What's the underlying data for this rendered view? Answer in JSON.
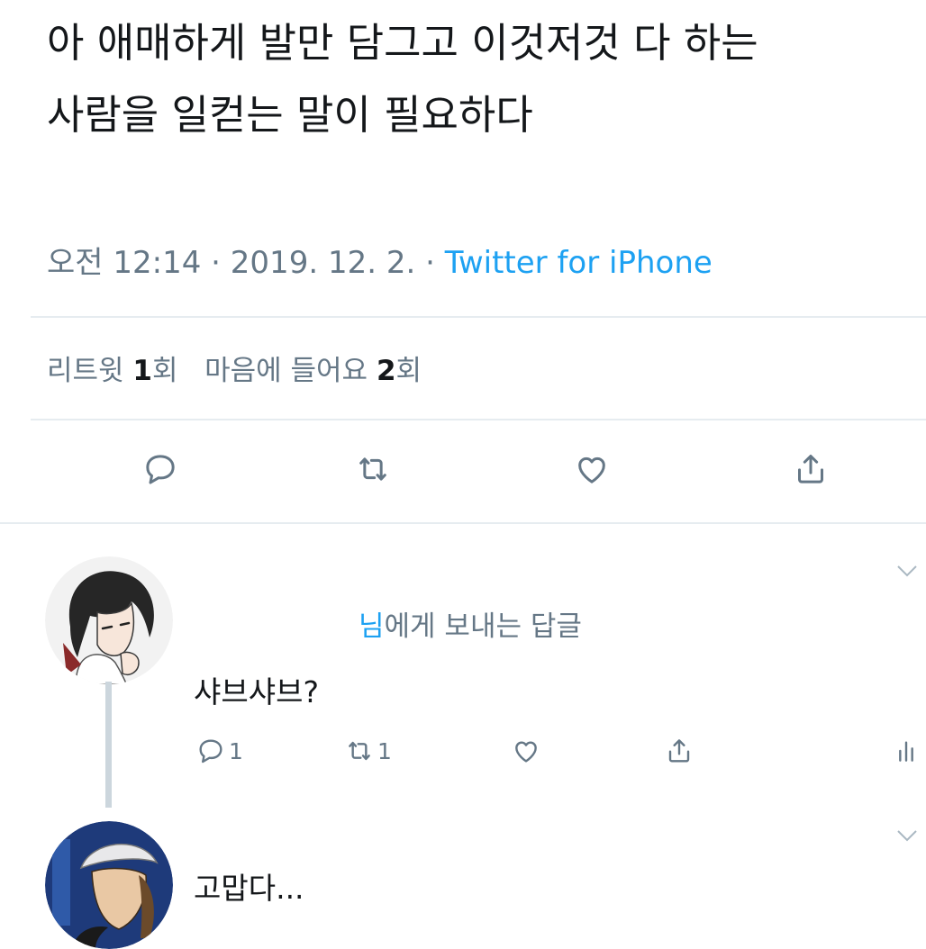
{
  "tweet": {
    "text_line1": "아 애매하게 발만 담그고 이것저것 다 하는",
    "text_line2": "사람을 일컫는 말이 필요하다",
    "time": "오전 12:14",
    "date": "2019. 12. 2.",
    "source": "Twitter for iPhone",
    "retweet_label": "리트윗",
    "retweet_count": "1",
    "retweet_unit": "회",
    "like_label": "마음에 들어요",
    "like_count": "2",
    "like_unit": "회"
  },
  "actions": {
    "reply_icon": "reply-icon",
    "retweet_icon": "retweet-icon",
    "like_icon": "heart-icon",
    "share_icon": "share-icon"
  },
  "reply1": {
    "reply_to_handle": "님",
    "reply_to_rest": "에게 보내는 답글",
    "text": "샤브샤브?",
    "reply_count": "1",
    "retweet_count": "1"
  },
  "reply2": {
    "text": "고맙다..."
  },
  "colors": {
    "accent": "#1da1f2",
    "muted": "#657786",
    "divider": "#e6ecf0",
    "text": "#14171a"
  }
}
